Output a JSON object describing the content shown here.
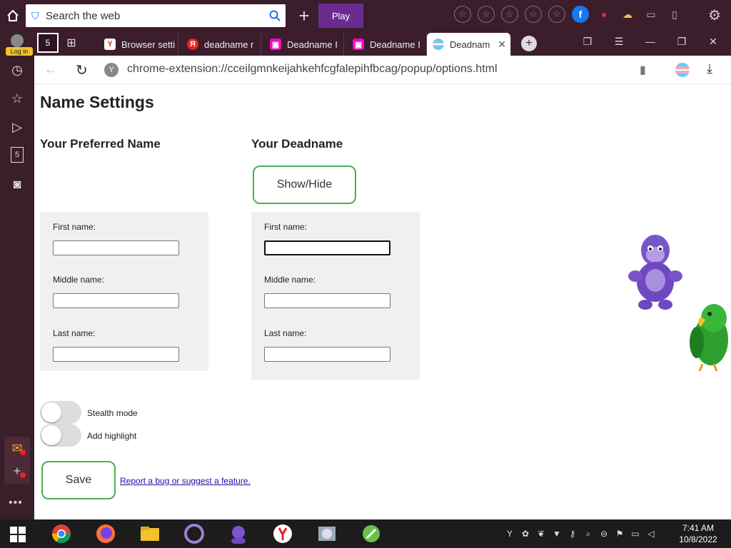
{
  "browser": {
    "search_placeholder": "Search the web",
    "play_label": "Play",
    "login_label": "Log in",
    "house_badge": "5",
    "sidebar_badge": "5",
    "url": "chrome-extension://cceilgmnkeijahkehfcgfalepihfbcag/popup/options.html",
    "tabs": [
      {
        "label": "Browser setti",
        "favicon": "yandex"
      },
      {
        "label": "deadname r",
        "favicon": "yandex-red"
      },
      {
        "label": "Deadname I",
        "favicon": "extension"
      },
      {
        "label": "Deadname I",
        "favicon": "extension"
      },
      {
        "label": "Deadnam",
        "favicon": "trans-flag",
        "active": true
      }
    ]
  },
  "page": {
    "title": "Name Settings",
    "preferred_heading": "Your Preferred Name",
    "deadname_heading": "Your Deadname",
    "show_hide_label": "Show/Hide",
    "first_name_label": "First name:",
    "middle_name_label": "Middle name:",
    "last_name_label": "Last name:",
    "stealth_label": "Stealth mode",
    "stealth_on": false,
    "highlight_label": "Add highlight",
    "highlight_on": false,
    "save_label": "Save",
    "report_link": "Report a bug or suggest a feature."
  },
  "taskbar": {
    "time": "7:41 AM",
    "date": "10/8/2022"
  },
  "colors": {
    "accent_green": "#4caf50",
    "browser_frame": "#3b1d2b",
    "play_purple": "#6a2c91"
  }
}
